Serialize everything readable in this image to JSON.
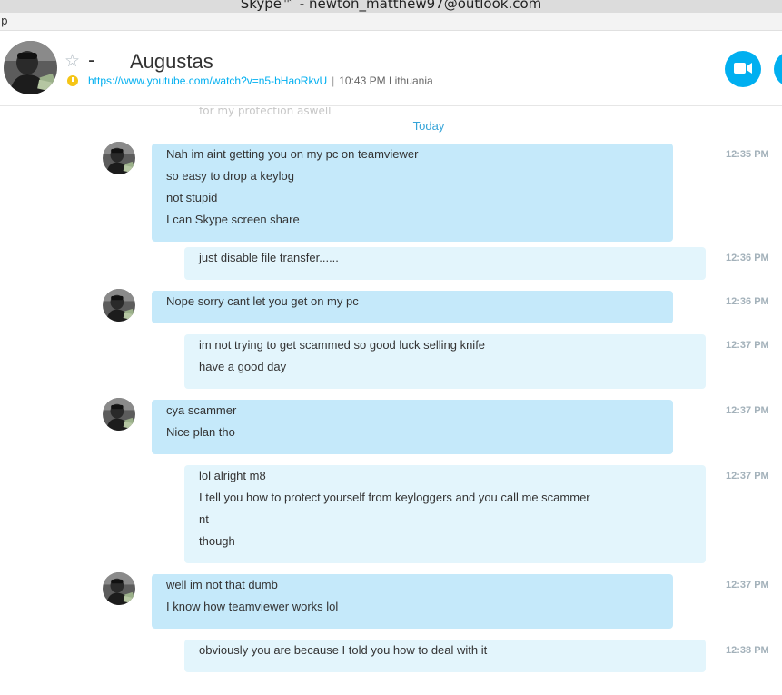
{
  "window": {
    "title": "Skype™ - newton_matthew97@outlook.com",
    "menu_fragment": "p"
  },
  "header": {
    "dash": "-",
    "contact_name": "Augustas",
    "mood_link": "https://www.youtube.com/watch?v=n5-bHaoRkvU",
    "separator": "|",
    "local_time": "10:43 PM Lithuania"
  },
  "chat": {
    "faded_previous": "for my protection aswell",
    "date_divider": "Today",
    "messages": [
      {
        "direction": "in",
        "time": "12:35 PM",
        "lines": [
          "Nah im aint getting you on my pc on teamviewer",
          "so easy to drop a keylog",
          "not stupid",
          "I can Skype screen share"
        ]
      },
      {
        "direction": "out",
        "time": "12:36 PM",
        "lines": [
          "just disable file transfer......"
        ]
      },
      {
        "direction": "in",
        "time": "12:36 PM",
        "lines": [
          "Nope sorry cant let you get on my pc"
        ]
      },
      {
        "direction": "out",
        "time": "12:37 PM",
        "lines": [
          "im not trying to get scammed so good luck selling knife",
          "have a good day"
        ]
      },
      {
        "direction": "in",
        "time": "12:37 PM",
        "lines": [
          "cya scammer",
          "Nice plan tho"
        ]
      },
      {
        "direction": "out",
        "time": "12:37 PM",
        "lines": [
          "lol alright m8",
          "I tell you how to protect yourself from keyloggers and you call me scammer",
          "nt",
          "though"
        ]
      },
      {
        "direction": "in",
        "time": "12:37 PM",
        "lines": [
          "well im not that dumb",
          "I know how teamviewer works lol"
        ]
      },
      {
        "direction": "out",
        "time": "12:38 PM",
        "lines": [
          "obviously you are because I told you how to deal with it"
        ]
      }
    ]
  },
  "icons": {
    "favorite": "star-outline-icon",
    "status": "away-clock-icon",
    "video": "video-camera-icon",
    "call": "phone-icon"
  },
  "colors": {
    "accent": "#00aff0",
    "incoming_bubble": "#c5e9fa",
    "outgoing_bubble": "#e3f5fc",
    "timestamp": "#a3b1ba",
    "away": "#f5c516"
  }
}
